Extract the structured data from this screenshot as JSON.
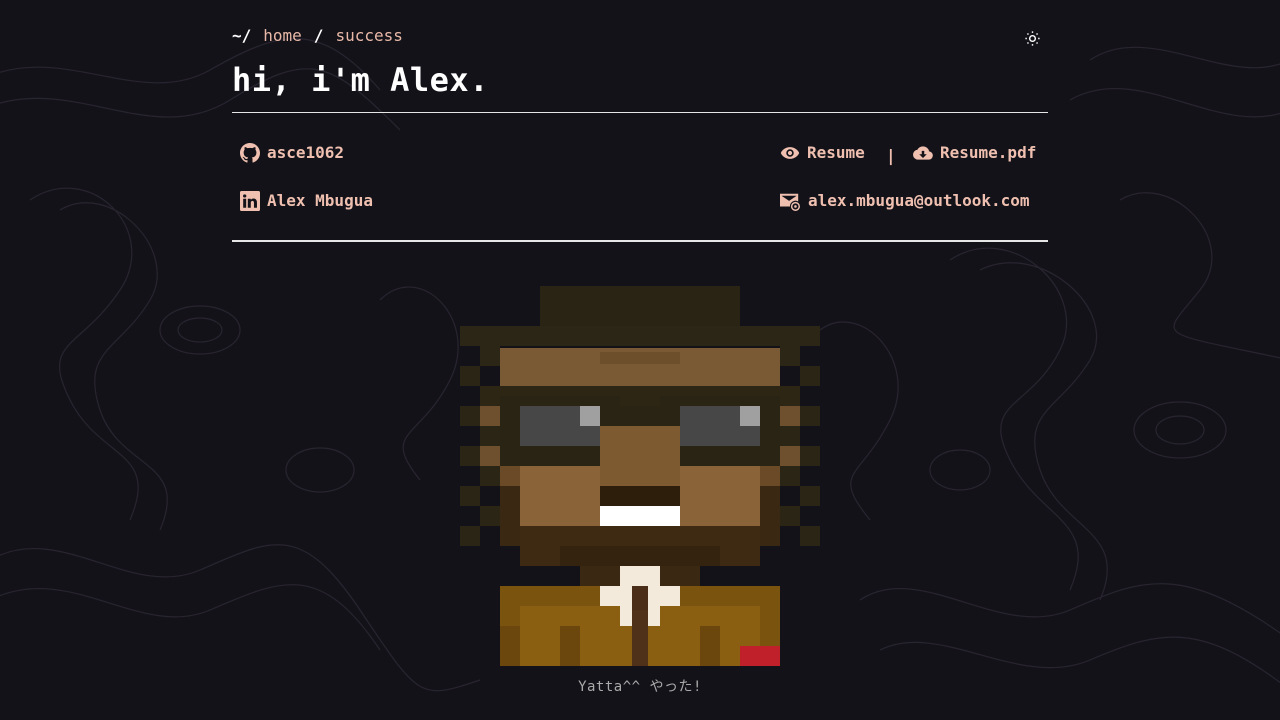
{
  "breadcrumb": {
    "root": "~/",
    "items": [
      "home",
      "success"
    ],
    "separator": "/"
  },
  "header": {
    "title": "hi, i'm Alex.",
    "theme_toggle_icon": "sun-icon"
  },
  "links": {
    "github": {
      "label": "asce1062",
      "icon": "github-icon"
    },
    "linkedin": {
      "label": "Alex Mbugua",
      "icon": "linkedin-icon"
    },
    "resume": {
      "label": "Resume",
      "icon": "eye-icon"
    },
    "resume_divider": "|",
    "resume_pdf": {
      "label": "Resume.pdf",
      "icon": "cloud-download-icon"
    },
    "email": {
      "label": "alex.mbugua@outlook.com",
      "icon": "mail-icon"
    }
  },
  "avatar": {
    "caption": "Yatta^^ やった!"
  },
  "colors": {
    "background": "#141219",
    "accent": "#efc0b0",
    "text": "#ffffff",
    "caption": "#a9a9a9"
  }
}
